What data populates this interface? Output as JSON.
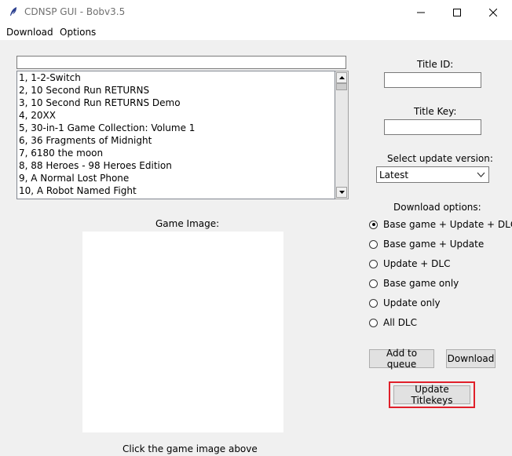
{
  "window": {
    "title": "CDNSP GUI - Bobv3.5"
  },
  "menu": {
    "download": "Download",
    "options": "Options"
  },
  "search": {
    "value": ""
  },
  "games": [
    "1, 1-2-Switch",
    "2, 10 Second Run RETURNS",
    "3, 10 Second Run RETURNS Demo",
    "4, 20XX",
    "5, 30-in-1 Game Collection: Volume 1",
    "6, 36 Fragments of Midnight",
    "7, 6180 the moon",
    "8, 88 Heroes - 98 Heroes Edition",
    "9, A Normal Lost Phone",
    "10, A Robot Named Fight"
  ],
  "labels": {
    "game_image": "Game Image:",
    "title_id": "Title ID:",
    "title_key": "Title Key:",
    "select_update": "Select update version:",
    "download_options": "Download options:",
    "click_hint": "Click the game image above"
  },
  "fields": {
    "title_id": "",
    "title_key": ""
  },
  "update_version": {
    "selected": "Latest"
  },
  "download_options": [
    {
      "label": "Base game + Update + DLC",
      "checked": true
    },
    {
      "label": "Base game + Update",
      "checked": false
    },
    {
      "label": "Update + DLC",
      "checked": false
    },
    {
      "label": "Base game only",
      "checked": false
    },
    {
      "label": "Update only",
      "checked": false
    },
    {
      "label": "All DLC",
      "checked": false
    }
  ],
  "buttons": {
    "add_to_queue": "Add to queue",
    "download": "Download",
    "update_titlekeys": "Update Titlekeys"
  },
  "colors": {
    "highlight": "#e0202a",
    "background": "#f0f0f0"
  }
}
